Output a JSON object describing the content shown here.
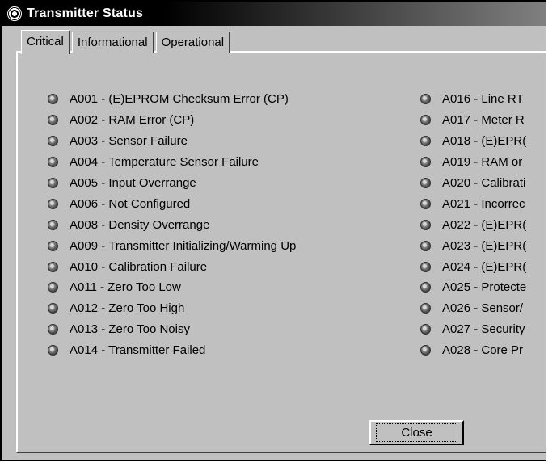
{
  "window": {
    "title": "Transmitter Status",
    "icon": "transmitter-app-icon"
  },
  "tabs": [
    {
      "label": "Critical",
      "active": true
    },
    {
      "label": "Informational",
      "active": false
    },
    {
      "label": "Operational",
      "active": false
    }
  ],
  "alarms_left": [
    "A001 - (E)EPROM Checksum Error (CP)",
    "A002 - RAM Error (CP)",
    "A003 - Sensor Failure",
    "A004 - Temperature Sensor Failure",
    "A005 - Input Overrange",
    "A006 - Not Configured",
    "A008 - Density Overrange",
    "A009 - Transmitter Initializing/Warming Up",
    "A010 - Calibration Failure",
    "A011 - Zero Too Low",
    "A012 - Zero Too High",
    "A013 - Zero Too Noisy",
    "A014 - Transmitter Failed"
  ],
  "alarms_right": [
    "A016 - Line RT",
    "A017 - Meter R",
    "A018 - (E)EPR(",
    "A019 - RAM or",
    "A020 - Calibrati",
    "A021 - Incorrec",
    "A022 - (E)EPR(",
    "A023 - (E)EPR(",
    "A024 - (E)EPR(",
    "A025 - Protecte",
    "A026 - Sensor/",
    "A027 - Security",
    "A028 - Core Pr"
  ],
  "close_button": {
    "label": "Close"
  },
  "led_state": "inactive-gray"
}
